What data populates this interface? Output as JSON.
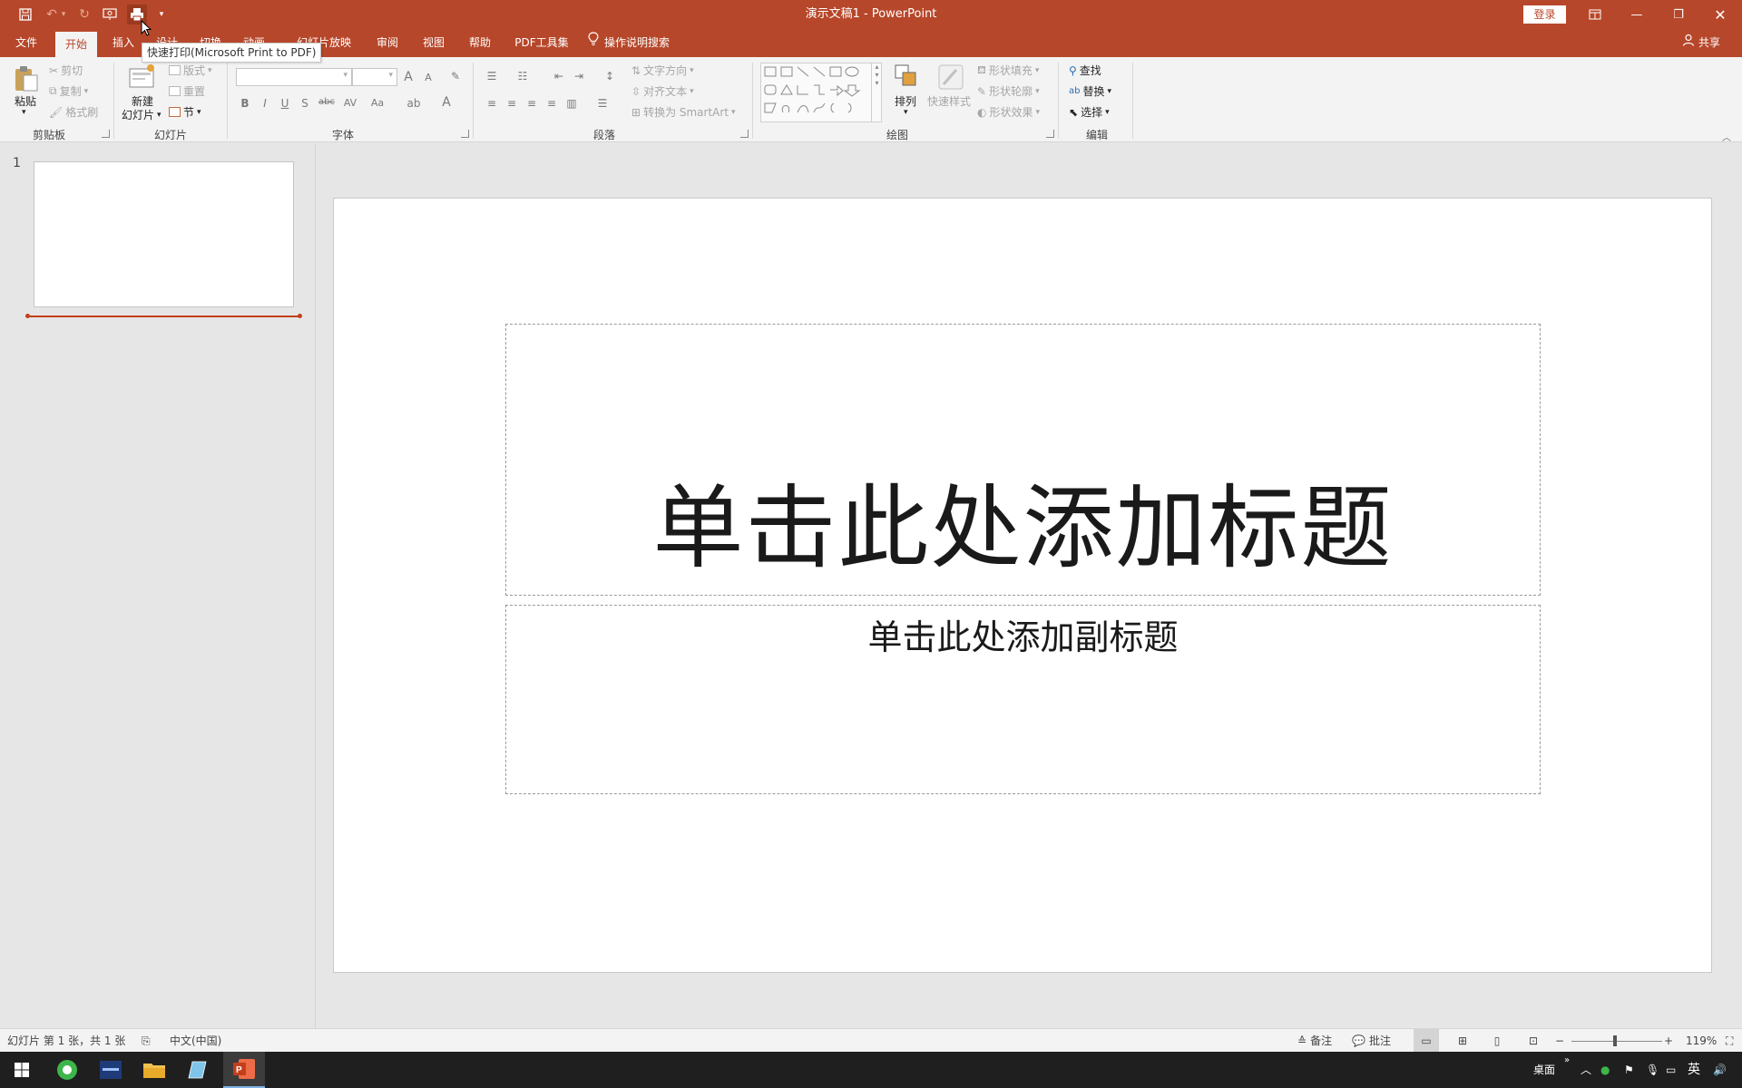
{
  "window": {
    "title": "演示文稿1  -  PowerPoint",
    "login_label": "登录",
    "tooltip": "快速打印(Microsoft Print to PDF)"
  },
  "tabs": [
    {
      "label": "文件"
    },
    {
      "label": "开始"
    },
    {
      "label": "插入"
    },
    {
      "label": "设计"
    },
    {
      "label": "切换"
    },
    {
      "label": "动画"
    },
    {
      "label": "幻灯片放映"
    },
    {
      "label": "审阅"
    },
    {
      "label": "视图"
    },
    {
      "label": "帮助"
    },
    {
      "label": "PDF工具集"
    }
  ],
  "tell_me": "操作说明搜索",
  "share_label": "共享",
  "ribbon": {
    "clipboard": {
      "label": "剪贴板",
      "paste": "粘贴",
      "cut": "剪切",
      "copy": "复制",
      "format_painter": "格式刷"
    },
    "slides": {
      "label": "幻灯片",
      "new_slide_1": "新建",
      "new_slide_2": "幻灯片",
      "layout": "版式",
      "reset": "重置",
      "section": "节"
    },
    "font": {
      "label": "字体",
      "bold": "B",
      "italic": "I",
      "underline": "U",
      "shadow": "S",
      "strike": "abc",
      "spacing": "AV",
      "case": "Aa",
      "grow": "A",
      "shrink": "A",
      "color": "A"
    },
    "paragraph": {
      "label": "段落",
      "text_direction": "文字方向",
      "align_text": "对齐文本",
      "smartart": "转换为 SmartArt"
    },
    "drawing": {
      "label": "绘图",
      "arrange": "排列",
      "quick_styles": "快速样式",
      "shape_fill": "形状填充",
      "shape_outline": "形状轮廓",
      "shape_effects": "形状效果"
    },
    "editing": {
      "label": "编辑",
      "find": "查找",
      "replace": "替换",
      "select": "选择"
    }
  },
  "thumbnails": [
    {
      "number": "1"
    }
  ],
  "slide": {
    "title_placeholder": "单击此处添加标题",
    "subtitle_placeholder": "单击此处添加副标题"
  },
  "status": {
    "slide_info": "幻灯片 第 1 张，共 1 张",
    "language": "中文(中国)",
    "notes": "备注",
    "comments": "批注",
    "zoom": "119%",
    "zoom_fraction": 0.48
  },
  "taskbar": {
    "desktop": "桌面",
    "ime": "英"
  },
  "colors": {
    "accent": "#b7472a",
    "tab_active_text": "#b7472a",
    "insert_marker": "#c43e1c"
  }
}
